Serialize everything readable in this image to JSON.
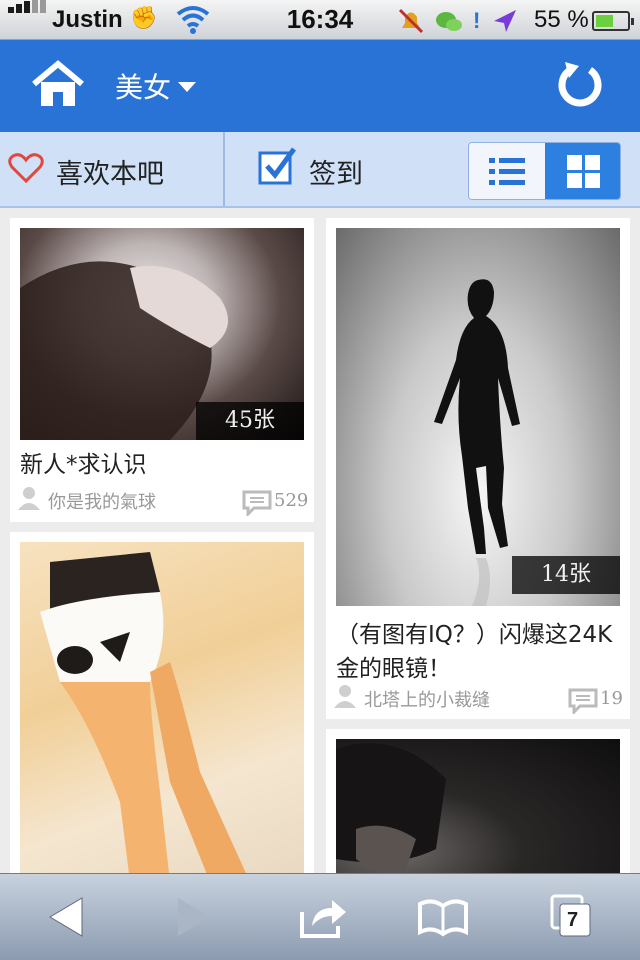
{
  "status_bar": {
    "carrier": "Justin",
    "time": "16:34",
    "battery": "55 %"
  },
  "header": {
    "title": "美女",
    "icons": [
      "home-icon",
      "chevron-down-icon",
      "refresh-icon"
    ]
  },
  "toolbar": {
    "like_label": "喜欢本吧",
    "sign_label": "签到",
    "icons": [
      "heart-icon",
      "checkbox-icon",
      "list-view-icon",
      "grid-view-icon"
    ],
    "active_view": "grid"
  },
  "posts": [
    {
      "photo_count": "45张",
      "title": "新人*求认识",
      "author": "你是我的氣球",
      "comments": "529"
    },
    {
      "photo_count": "14张",
      "title_line1": "（有图有IQ？）闪爆这24K",
      "title_line2": "金的眼镜！",
      "author": "北塔上的小裁缝",
      "comments": "19"
    },
    {},
    {}
  ],
  "bottom_bar": {
    "tab_count": "7",
    "icons": [
      "back-arrow-icon",
      "forward-arrow-icon",
      "share-icon",
      "bookmarks-icon",
      "tabs-icon"
    ]
  },
  "colors": {
    "header_blue": "#2a73d6",
    "toolbar_blue": "#cfe0f7",
    "heart_red": "#e0473d",
    "active_toggle": "#2d7fe0"
  }
}
